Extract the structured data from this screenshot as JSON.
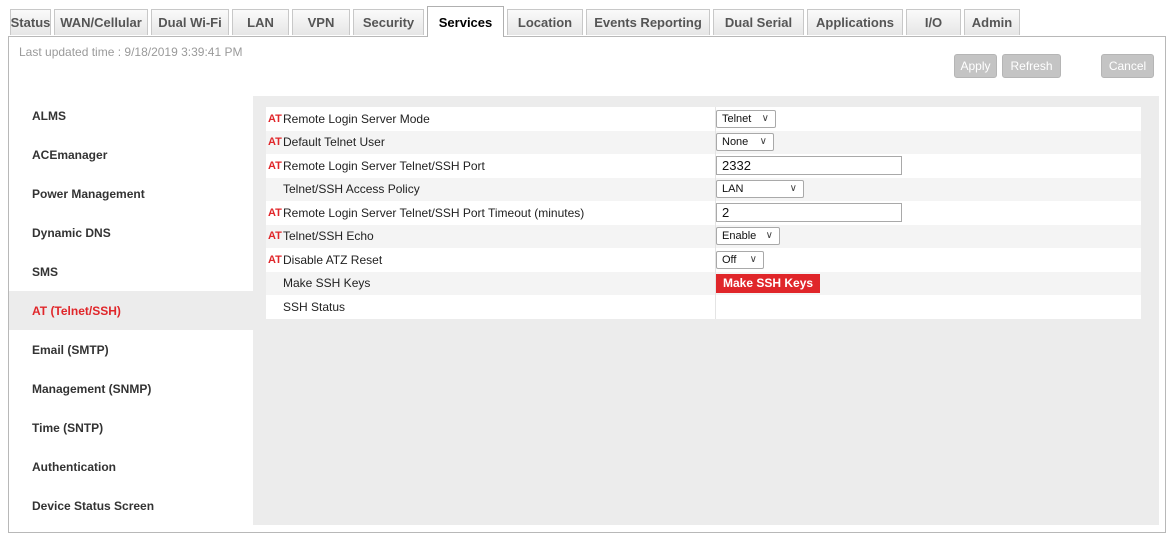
{
  "tabs": [
    {
      "label": "Status"
    },
    {
      "label": "WAN/Cellular"
    },
    {
      "label": "Dual Wi-Fi"
    },
    {
      "label": "LAN"
    },
    {
      "label": "VPN"
    },
    {
      "label": "Security"
    },
    {
      "label": "Services"
    },
    {
      "label": "Location"
    },
    {
      "label": "Events Reporting"
    },
    {
      "label": "Dual Serial"
    },
    {
      "label": "Applications"
    },
    {
      "label": "I/O"
    },
    {
      "label": "Admin"
    }
  ],
  "active_tab": "Services",
  "header": {
    "updated": "Last updated time : 9/18/2019 3:39:41 PM",
    "apply": "Apply",
    "refresh": "Refresh",
    "cancel": "Cancel"
  },
  "sidebar": {
    "items": [
      {
        "label": "ALMS"
      },
      {
        "label": "ACEmanager"
      },
      {
        "label": "Power Management"
      },
      {
        "label": "Dynamic DNS"
      },
      {
        "label": "SMS"
      },
      {
        "label": "AT (Telnet/SSH)"
      },
      {
        "label": "Email (SMTP)"
      },
      {
        "label": "Management (SNMP)"
      },
      {
        "label": "Time (SNTP)"
      },
      {
        "label": "Authentication"
      },
      {
        "label": "Device Status Screen"
      }
    ],
    "active": "AT (Telnet/SSH)"
  },
  "settings": {
    "at_marker": "AT",
    "rows": [
      {
        "at": true,
        "label": "Remote Login Server Mode",
        "type": "select",
        "value": "Telnet"
      },
      {
        "at": true,
        "label": "Default Telnet User",
        "type": "select",
        "value": "None"
      },
      {
        "at": true,
        "label": "Remote Login Server Telnet/SSH Port",
        "type": "text",
        "value": "2332"
      },
      {
        "at": false,
        "label": "Telnet/SSH Access Policy",
        "type": "select",
        "value": "LAN"
      },
      {
        "at": true,
        "label": "Remote Login Server Telnet/SSH Port Timeout (minutes)",
        "type": "text",
        "value": "2"
      },
      {
        "at": true,
        "label": "Telnet/SSH Echo",
        "type": "select",
        "value": "Enable"
      },
      {
        "at": true,
        "label": "Disable ATZ Reset",
        "type": "select",
        "value": "Off"
      },
      {
        "at": false,
        "label": "Make SSH Keys",
        "type": "button",
        "value": "Make SSH Keys"
      },
      {
        "at": false,
        "label": "SSH Status",
        "type": "none",
        "value": ""
      }
    ]
  },
  "colors": {
    "accent_red": "#e0262a",
    "panel_bg": "#ececec",
    "button_gray": "#c4c4c4"
  },
  "icons": {
    "select_chevron": "chevron-down-icon"
  }
}
